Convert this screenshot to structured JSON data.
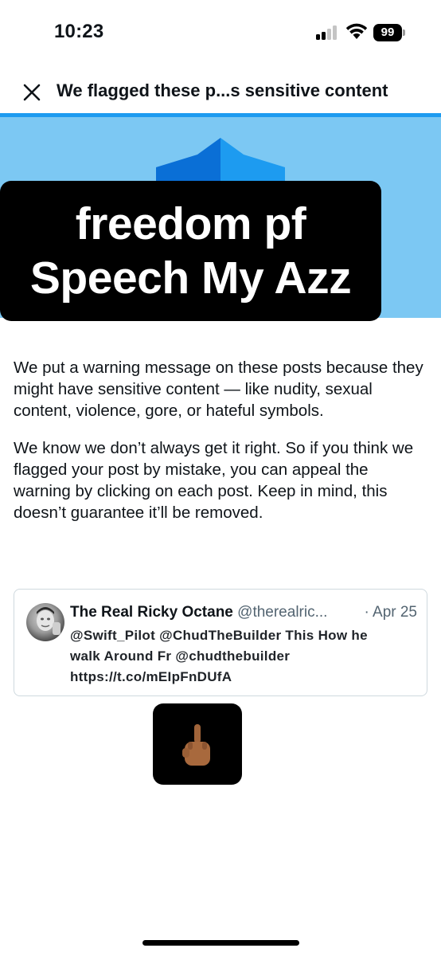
{
  "status_bar": {
    "time": "10:23",
    "battery": "99",
    "icons": [
      "cellular-signal-icon",
      "wifi-icon",
      "battery-icon"
    ]
  },
  "header": {
    "close_icon": "close-icon",
    "title": "We flagged these p...s sensitive content"
  },
  "banner": {
    "colors": {
      "background": "#7cc8f3",
      "shape_dark": "#0a6fd6",
      "shape_light": "#1d9bf0"
    }
  },
  "meme": {
    "line1": "freedom pf",
    "line2": "Speech My Azz"
  },
  "body": {
    "paragraph1": "We put a warning message on these posts because they might have sensitive content — like nudity, sexual content, violence, gore, or hateful symbols.",
    "paragraph2": "We know we don’t always get it right. So if you think we flagged your post by mistake, you can appeal the warning by clicking on each post. Keep in mind, this doesn’t guarantee it’ll be removed."
  },
  "tweet": {
    "name": "The Real Ricky Octane",
    "handle": "@therealric...",
    "separator": "·",
    "date": "Apr 25",
    "text_line1": "@Swift_Pilot @ChudTheBuilder This How he",
    "text_line2": "walk Around Fr @chudthebuilder",
    "text_line3": "https://t.co/mEIpFnDUfA",
    "media_icon": "middle-finger-emoji-icon"
  },
  "colors": {
    "accent": "#1d9bf0",
    "text_primary": "#0f1419",
    "text_secondary": "#536471",
    "border": "#cfd9de"
  }
}
